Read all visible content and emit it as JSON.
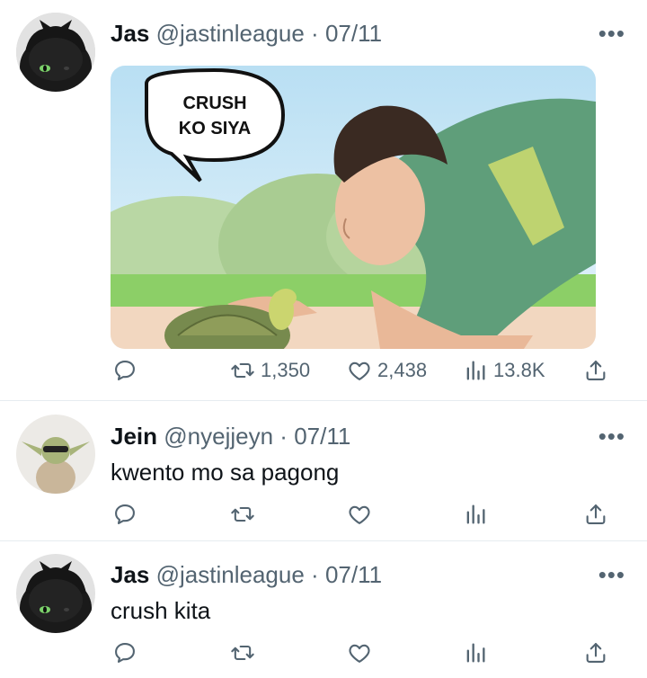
{
  "tweets": [
    {
      "name": "Jas",
      "handle": "@jastinleague",
      "sep": "·",
      "date": "07/11",
      "more": "•••",
      "text": "",
      "image_caption": "CRUSH\nKO SIYA",
      "caption_line1": "CRUSH",
      "caption_line2": "KO SIYA",
      "retweets": "1,350",
      "likes": "2,438",
      "views": "13.8K"
    },
    {
      "name": "Jein",
      "handle": "@nyejjeyn",
      "sep": "·",
      "date": "07/11",
      "more": "•••",
      "text": "kwento mo sa pagong"
    },
    {
      "name": "Jas",
      "handle": "@jastinleague",
      "sep": "·",
      "date": "07/11",
      "more": "•••",
      "text": "crush kita"
    }
  ],
  "icons": {
    "reply": "reply-icon",
    "retweet": "retweet-icon",
    "like": "heart-icon",
    "views": "views-icon",
    "share": "share-icon",
    "more": "more-icon"
  },
  "colors": {
    "text": "#0f1419",
    "secondary": "#536471",
    "divider": "#e6ecf0"
  }
}
